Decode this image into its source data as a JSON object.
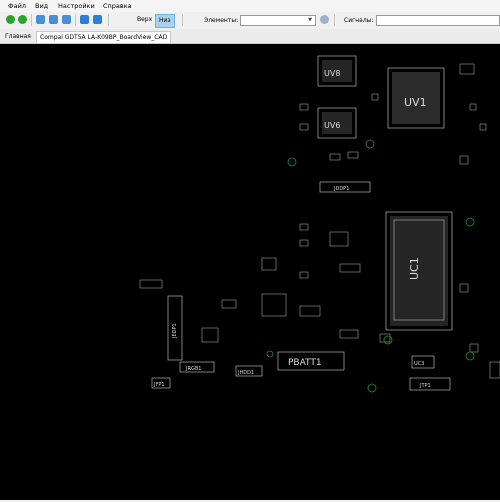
{
  "menu": {
    "file": "Файл",
    "view": "Вид",
    "settings": "Настройки",
    "help": "Справка"
  },
  "toolbar": {
    "top_label": "Верх",
    "bottom_label": "Низ",
    "elements_label": "Элементы:",
    "elements_value": "",
    "signals_label": "Сигналы:",
    "signals_value": "",
    "colors": {
      "accent": "#a6d2f0",
      "green": "#2aa52a"
    }
  },
  "tabs": [
    {
      "label": "Главная"
    },
    {
      "label": "Compal GDT5A LA-K09BP_BoardView_CAD"
    }
  ],
  "board": {
    "labels": {
      "uv8": "UV8",
      "uv6": "UV6",
      "uv1": "UV1",
      "uc1": "UC1",
      "pbatt1": "PBATT1",
      "jdsp1": "JDDP1",
      "jedp1": "JEDP1",
      "jrgb1": "JRGB1",
      "jhdd1": "JHDD1",
      "jfp1": "JFP1",
      "uc3": "UC3",
      "jtp1": "JTP1"
    }
  }
}
